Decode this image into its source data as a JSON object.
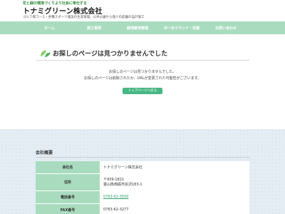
{
  "header": {
    "tagline": "花と緑の環境づくりより社会に奉仕する",
    "company_name": "トナミグリーン株式会社",
    "subline": "ゴルフ場コース・各種スポーツ施設の生涯管理、公共公園から個人の庭園の設計施工"
  },
  "nav": {
    "items": [
      {
        "label": "ホーム"
      },
      {
        "label": "施工事例"
      },
      {
        "label": "緑地維持管理"
      },
      {
        "label": "ゆーゆうランド・花椿"
      },
      {
        "label": "お問い合わせ"
      }
    ]
  },
  "breadcrumb": {
    "text": "· · ·"
  },
  "notfound": {
    "title": "お探しのページは見つかりませんでした",
    "message_line1": "お探しのページは見つかりませんでした。",
    "message_line2": "お探しのページは削除されたか、URLが変更された可能性がございます。",
    "button_label": "トップページへ戻る"
  },
  "company": {
    "section_title": "会社概要",
    "rows": [
      {
        "label": "会社名",
        "value": "トナミグリーン株式会社"
      },
      {
        "label": "住所",
        "value_line1": "〒939-1821",
        "value_line2": "富山県南砺市宗沢183-1"
      },
      {
        "label": "電話番号",
        "value": "0763-62-3500"
      },
      {
        "label": "FAX番号",
        "value": "0763-62-3277"
      }
    ]
  },
  "colors": {
    "nav_bg": "#a9dcbf",
    "accent": "#48b883",
    "footer_bg": "#e4edf3"
  }
}
